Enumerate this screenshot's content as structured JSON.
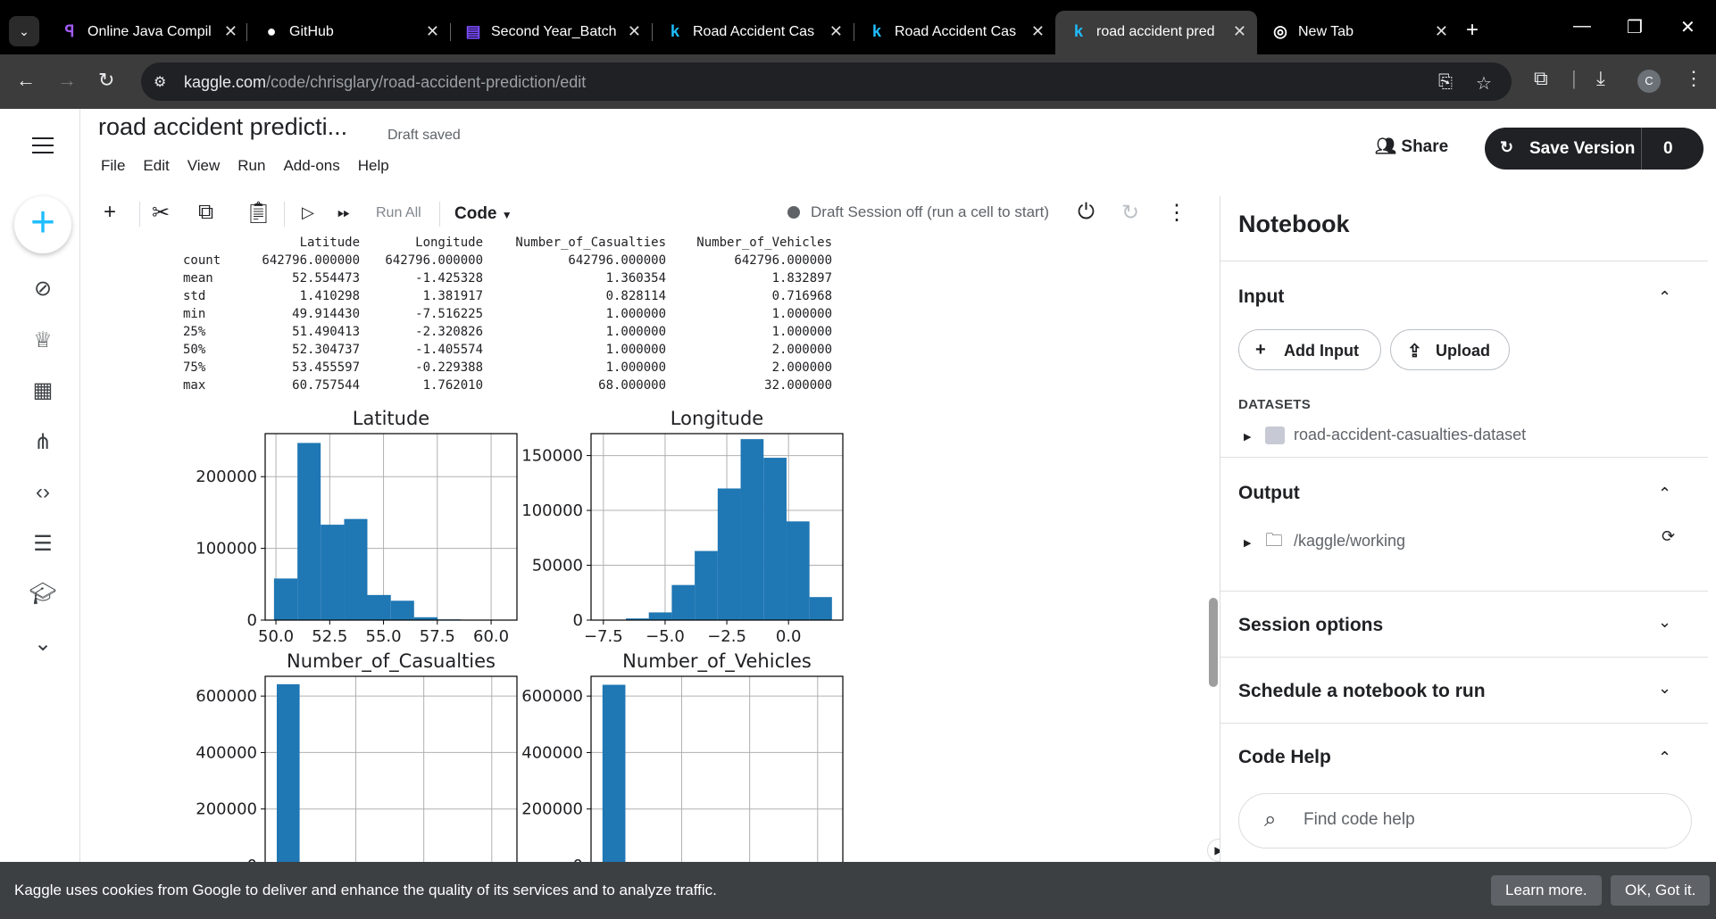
{
  "browser": {
    "tabs": [
      {
        "title": "Online Java Compil",
        "icon": "jdoodle-icon"
      },
      {
        "title": "GitHub",
        "icon": "github-icon"
      },
      {
        "title": "Second Year_Batch",
        "icon": "sheets-icon"
      },
      {
        "title": "Road Accident Cas",
        "icon": "kaggle-icon"
      },
      {
        "title": "Road Accident Cas",
        "icon": "kaggle-icon"
      },
      {
        "title": "road accident pred",
        "icon": "kaggle-icon",
        "active": true
      },
      {
        "title": "New Tab",
        "icon": "chrome-icon"
      }
    ],
    "url_host": "kaggle.com",
    "url_path": "/code/chrisglary/road-accident-prediction/edit",
    "profile_initial": "C"
  },
  "notebook": {
    "title": "road accident predicti...",
    "status": "Draft saved",
    "menu": [
      "File",
      "Edit",
      "View",
      "Run",
      "Add-ons",
      "Help"
    ],
    "share_label": "Share",
    "save_version_label": "Save Version",
    "save_version_count": "0",
    "run_all_label": "Run All",
    "cell_type": "Code",
    "session_status": "Draft Session off (run a cell to start)"
  },
  "describe_table": {
    "columns": [
      "Latitude",
      "Longitude",
      "Number_of_Casualties",
      "Number_of_Vehicles"
    ],
    "rows": [
      {
        "idx": "count",
        "vals": [
          "642796.000000",
          "642796.000000",
          "642796.000000",
          "642796.000000"
        ]
      },
      {
        "idx": "mean",
        "vals": [
          "52.554473",
          "-1.425328",
          "1.360354",
          "1.832897"
        ]
      },
      {
        "idx": "std",
        "vals": [
          "1.410298",
          "1.381917",
          "0.828114",
          "0.716968"
        ]
      },
      {
        "idx": "min",
        "vals": [
          "49.914430",
          "-7.516225",
          "1.000000",
          "1.000000"
        ]
      },
      {
        "idx": "25%",
        "vals": [
          "51.490413",
          "-2.320826",
          "1.000000",
          "1.000000"
        ]
      },
      {
        "idx": "50%",
        "vals": [
          "52.304737",
          "-1.405574",
          "1.000000",
          "2.000000"
        ]
      },
      {
        "idx": "75%",
        "vals": [
          "53.455597",
          "-0.229388",
          "1.000000",
          "2.000000"
        ]
      },
      {
        "idx": "max",
        "vals": [
          "60.757544",
          "1.762010",
          "68.000000",
          "32.000000"
        ]
      }
    ]
  },
  "chart_data": [
    {
      "type": "bar",
      "title": "Latitude",
      "xlim": [
        49.5,
        61.2
      ],
      "ylim": [
        0,
        260000
      ],
      "xticks": [
        "50.0",
        "52.5",
        "55.0",
        "57.5",
        "60.0"
      ],
      "xtick_values": [
        50.0,
        52.5,
        55.0,
        57.5,
        60.0
      ],
      "yticks": [
        "0",
        "100000",
        "200000"
      ],
      "ytick_values": [
        0,
        100000,
        200000
      ],
      "bin_edges": [
        49.91,
        51.0,
        52.08,
        53.17,
        54.25,
        55.34,
        56.42,
        57.51,
        58.59,
        59.67,
        60.76
      ],
      "values": [
        58000,
        247000,
        133000,
        141000,
        35000,
        27000,
        4000,
        1000,
        200,
        100
      ],
      "grid": true,
      "color": "#1f77b4"
    },
    {
      "type": "bar",
      "title": "Longitude",
      "xlim": [
        -8.0,
        2.2
      ],
      "ylim": [
        0,
        170000
      ],
      "xticks": [
        "−7.5",
        "−5.0",
        "−2.5",
        "0.0"
      ],
      "xtick_values": [
        -7.5,
        -5.0,
        -2.5,
        0.0
      ],
      "yticks": [
        "0",
        "50000",
        "100000",
        "150000"
      ],
      "ytick_values": [
        0,
        50000,
        100000,
        150000
      ],
      "bin_edges": [
        -7.52,
        -6.59,
        -5.66,
        -4.73,
        -3.8,
        -2.87,
        -1.94,
        -1.01,
        -0.08,
        0.85,
        1.76
      ],
      "values": [
        200,
        1500,
        7000,
        32000,
        63000,
        120000,
        165000,
        148000,
        90000,
        21000
      ],
      "grid": true,
      "color": "#1f77b4"
    },
    {
      "type": "bar",
      "title": "Number_of_Casualties",
      "xlim": [
        -2.4,
        71.4
      ],
      "ylim": [
        0,
        670000
      ],
      "xticks": [],
      "xtick_values": [],
      "yticks": [
        "0",
        "200000",
        "400000",
        "600000"
      ],
      "ytick_values": [
        0,
        200000,
        400000,
        600000
      ],
      "bin_edges": [
        1,
        7.7,
        14.4,
        21.1,
        27.8,
        34.5,
        41.2,
        47.9,
        54.6,
        61.3,
        68
      ],
      "values": [
        642000,
        600,
        100,
        40,
        20,
        10,
        5,
        3,
        2,
        1
      ],
      "grid": true,
      "color": "#1f77b4"
    },
    {
      "type": "bar",
      "title": "Number_of_Vehicles",
      "xlim": [
        -0.55,
        33.55
      ],
      "ylim": [
        0,
        670000
      ],
      "xticks": [],
      "xtick_values": [],
      "yticks": [
        "0",
        "200000",
        "400000",
        "600000"
      ],
      "ytick_values": [
        0,
        200000,
        400000,
        600000
      ],
      "bin_edges": [
        1,
        4.1,
        7.2,
        10.3,
        13.4,
        16.5,
        19.6,
        22.7,
        25.8,
        28.9,
        32
      ],
      "values": [
        640000,
        2500,
        200,
        50,
        20,
        10,
        5,
        3,
        2,
        1
      ],
      "grid": true,
      "color": "#1f77b4"
    }
  ],
  "right_panel": {
    "title": "Notebook",
    "input": {
      "heading": "Input",
      "add_input_label": "Add Input",
      "upload_label": "Upload",
      "datasets_heading": "DATASETS",
      "dataset_name": "road-accident-casualties-dataset"
    },
    "output": {
      "heading": "Output",
      "folder": "/kaggle/working"
    },
    "session_options": "Session options",
    "schedule": "Schedule a notebook to run",
    "code_help": {
      "heading": "Code Help",
      "placeholder": "Find code help"
    }
  },
  "cookie_banner": {
    "message": "Kaggle uses cookies from Google to deliver and enhance the quality of its services and to analyze traffic.",
    "learn_more": "Learn more.",
    "ok": "OK, Got it."
  }
}
